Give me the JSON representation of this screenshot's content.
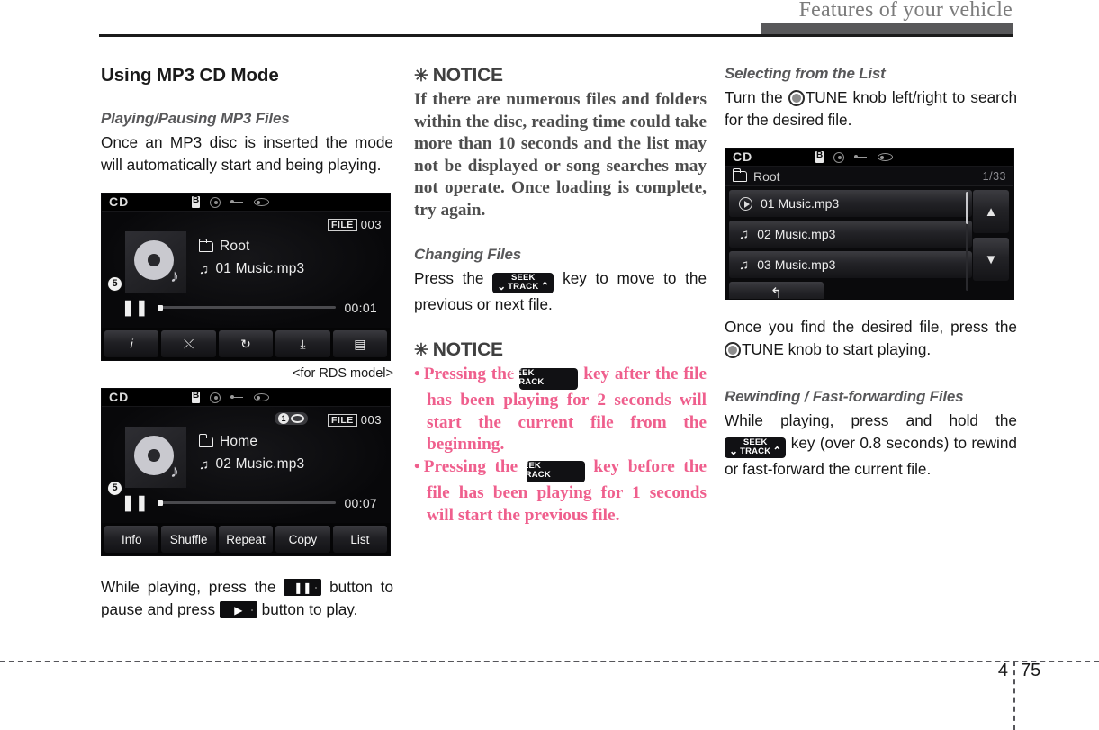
{
  "header": {
    "title": "Features of your vehicle"
  },
  "footer": {
    "chapter": "4",
    "page": "75"
  },
  "left": {
    "section_title": "Using MP3 CD Mode",
    "sub1": "Playing/Pausing MP3 Files",
    "para1": "Once an MP3 disc is inserted the mode will automatically start and being playing.",
    "caption": "<for RDS model>",
    "para_bottom_1": "While playing, press the",
    "para_bottom_2": "button to pause and press",
    "para_bottom_3": "button to play.",
    "pause_glyph": "❚❚",
    "play_glyph": "▶"
  },
  "mid": {
    "notice1_head": "NOTICE",
    "notice1_asterisk": "✳",
    "notice1_body": "If there are numerous files and folders within the disc, reading time could take more than 10 seconds and the list may not be displayed or song searches may not operate. Once loading is complete, try again.",
    "sub_changing": "Changing Files",
    "changing_1": "Press the",
    "changing_2": "key to move to the previous or next file.",
    "notice2_head": "NOTICE",
    "notice2_asterisk": "✳",
    "bullet1_pre": "Pressing the",
    "bullet1_post": "key after the file has been playing for 2 seconds will start the current file from the beginning.",
    "bullet2_pre": "Pressing the",
    "bullet2_post": "key before the file has been playing for 1 seconds will start the previous file.",
    "bullet_char": "•"
  },
  "right": {
    "sub_select": "Selecting from the List",
    "select_1": "Turn the",
    "select_2": "TUNE knob left/right to search for the desired file.",
    "after_1": "Once you find the desired file, press the",
    "after_2": "TUNE knob to start playing.",
    "sub_rewind": "Rewinding / Fast-forwarding Files",
    "rewind_1": "While playing, press and hold the",
    "rewind_2": "key (over 0.8 seconds) to rewind or fast-forward the current file."
  },
  "key_graphic": {
    "seek": "SEEK",
    "track": "TRACK",
    "chev_down": "⌄",
    "chev_up": "⌃"
  },
  "screens": {
    "screen1": {
      "cd_label": "CD",
      "file_label": "FILE",
      "file_number": "003",
      "folder": "Root",
      "track": "01 Music.mp3",
      "time": "00:01",
      "callout": "5",
      "toolbar": [
        {
          "name": "info-icon",
          "glyph": "𝑖"
        },
        {
          "name": "shuffle-icon",
          "glyph": "⤬"
        },
        {
          "name": "repeat-icon",
          "glyph": "↻"
        },
        {
          "name": "copy-icon",
          "glyph": "⤓"
        },
        {
          "name": "list-icon",
          "glyph": "▤"
        }
      ]
    },
    "screen2": {
      "cd_label": "CD",
      "file_label": "FILE",
      "file_number": "003",
      "repeat_one": "1",
      "folder": "Home",
      "track": "02 Music.mp3",
      "time": "00:07",
      "callout": "5",
      "toolbar": [
        "Info",
        "Shuffle",
        "Repeat",
        "Copy",
        "List"
      ]
    },
    "screen3": {
      "cd_label": "CD",
      "folder": "Root",
      "counter": "1/33",
      "rows": [
        "01 Music.mp3",
        "02 Music.mp3",
        "03 Music.mp3"
      ],
      "up_arrow": "▲",
      "down_arrow": "▼",
      "back_glyph": "↰"
    }
  }
}
